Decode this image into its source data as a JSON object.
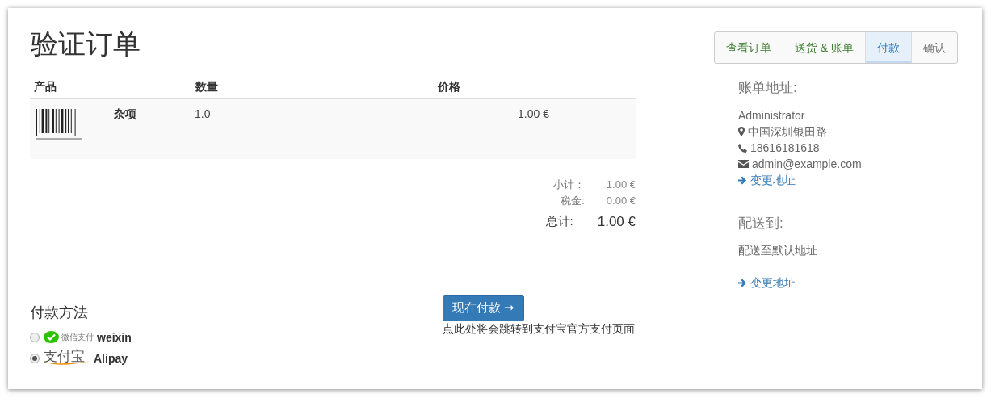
{
  "title": "验证订单",
  "steps": [
    {
      "label": "查看订单",
      "done": true,
      "selected": false
    },
    {
      "label": "送货 & 账单",
      "done": true,
      "selected": false
    },
    {
      "label": "付款",
      "done": false,
      "selected": true
    },
    {
      "label": "确认",
      "done": false,
      "selected": false
    }
  ],
  "table": {
    "columns": [
      "产品",
      "数量",
      "价格"
    ],
    "rows": [
      {
        "name": "杂项",
        "quantity": "1.0",
        "price": "1.00 €"
      }
    ]
  },
  "totals": [
    {
      "label": "小计：",
      "value": "1.00 €",
      "kind": "sub"
    },
    {
      "label": "税金:",
      "value": "0.00 €",
      "kind": "sub"
    },
    {
      "label": "总计:",
      "value": "1.00 €",
      "kind": "total"
    }
  ],
  "billing": {
    "heading": "账单地址:",
    "name": "Administrator",
    "lines": [
      {
        "kind": "address",
        "text": "中国深圳银田路"
      },
      {
        "kind": "phone",
        "text": "18616181618"
      },
      {
        "kind": "email",
        "text": "admin@example.com"
      }
    ],
    "link": "变更地址"
  },
  "shipping": {
    "heading": "配送到:",
    "text": "配送至默认地址",
    "link": "变更地址"
  },
  "payment": {
    "heading": "付款方法",
    "methods": [
      {
        "kind": "wechat",
        "logo_text": "微信支付",
        "label": "weixin",
        "selected": false
      },
      {
        "kind": "alipay",
        "logo_text": "支付宝",
        "label": "Alipay",
        "selected": true
      }
    ]
  },
  "pay_button": {
    "label": "现在付款 ➞",
    "note": "点此处将会跳转到支付宝官方支付页面"
  }
}
